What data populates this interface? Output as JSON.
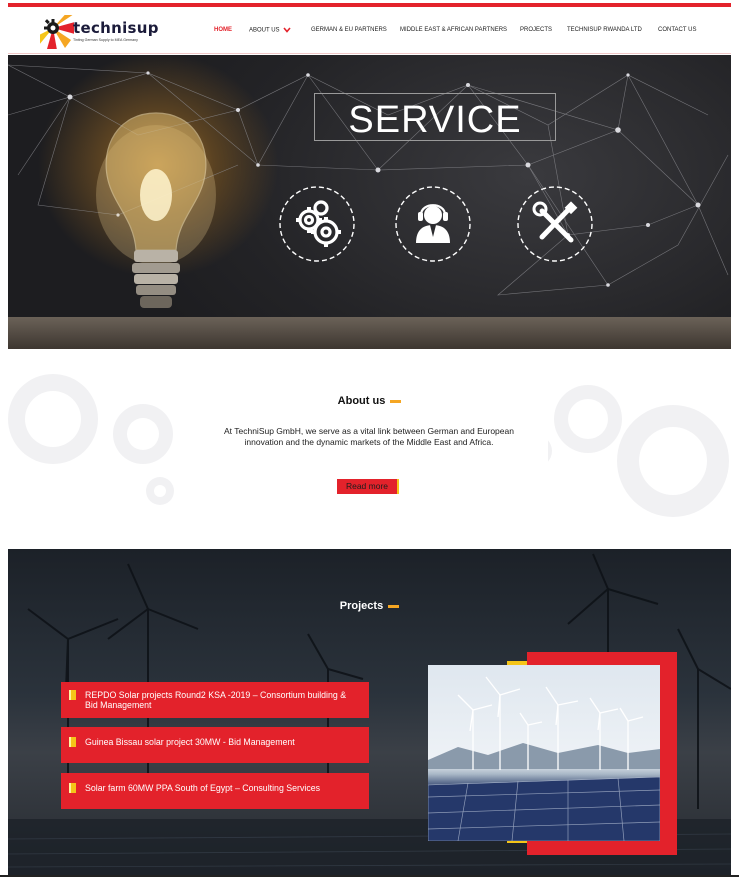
{
  "header": {
    "logo_name": "technisup",
    "logo_tagline": "Tinting German Supply to MEA Germany",
    "nav": [
      {
        "label": "HOME",
        "active": true
      },
      {
        "label": "ABOUT US",
        "active": false,
        "has_dropdown": true
      },
      {
        "label": "GERMAN & EU PARTNERS",
        "active": false
      },
      {
        "label": "MIDDLE EAST & AFRICAN PARTNERS",
        "active": false
      },
      {
        "label": "PROJECTS",
        "active": false
      },
      {
        "label": "TECHNISUP RWANDA LTD",
        "active": false
      },
      {
        "label": "CONTACT US",
        "active": false
      }
    ]
  },
  "hero": {
    "title": "SERVICE",
    "icons": [
      "gears-icon",
      "support-agent-icon",
      "tools-icon"
    ]
  },
  "about": {
    "title": "About us",
    "text": "At TechniSup GmbH, we serve as a vital link between German and European innovation and the dynamic markets of the Middle East and Africa.",
    "button_label": "Read more"
  },
  "projects": {
    "title": "Projects",
    "items": [
      "REPDO Solar projects Round2 KSA -2019 – Consortium building & Bid Management",
      "Guinea Bissau solar project 30MW - Bid Management",
      "Solar farm 60MW PPA South of Egypt – Consulting Services"
    ]
  },
  "colors": {
    "accent_red": "#e3222b",
    "accent_yellow": "#f5c518",
    "dark_bg": "#232326"
  }
}
